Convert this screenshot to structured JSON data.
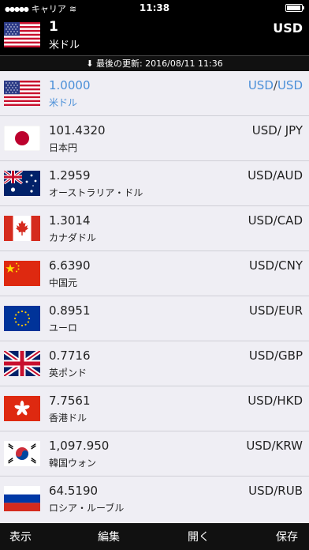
{
  "status_bar": {
    "carrier": "キャリア",
    "time": "11:38"
  },
  "header": {
    "amount": "1",
    "currency_name": "米ドル",
    "currency_code": "USD",
    "flag_icon": "us-flag-icon"
  },
  "updated": {
    "text": "⬇ 最後の更新: 2016/08/11 11:36"
  },
  "rates": [
    {
      "rate": "1.0000",
      "name": "米ドル",
      "base": "USD",
      "sep": "/",
      "quote": "USD",
      "flag": "us-flag-icon",
      "highlight": "#4a8fd8"
    },
    {
      "rate": "101.4320",
      "name": "日本円",
      "base": "USD",
      "sep": "/ ",
      "quote": "JPY",
      "flag": "jp-flag-icon"
    },
    {
      "rate": "1.2959",
      "name": "オーストラリア・ドル",
      "base": "USD",
      "sep": "/",
      "quote": "AUD",
      "flag": "au-flag-icon"
    },
    {
      "rate": "1.3014",
      "name": "カナダドル",
      "base": "USD",
      "sep": "/",
      "quote": "CAD",
      "flag": "ca-flag-icon"
    },
    {
      "rate": "6.6390",
      "name": "中国元",
      "base": "USD",
      "sep": "/",
      "quote": "CNY",
      "flag": "cn-flag-icon"
    },
    {
      "rate": "0.8951",
      "name": "ユーロ",
      "base": "USD",
      "sep": "/",
      "quote": "EUR",
      "flag": "eu-flag-icon"
    },
    {
      "rate": "0.7716",
      "name": "英ポンド",
      "base": "USD",
      "sep": "/",
      "quote": "GBP",
      "flag": "gb-flag-icon"
    },
    {
      "rate": "7.7561",
      "name": "香港ドル",
      "base": "USD",
      "sep": "/",
      "quote": "HKD",
      "flag": "hk-flag-icon"
    },
    {
      "rate": "1,097.950",
      "name": "韓国ウォン",
      "base": "USD",
      "sep": "/",
      "quote": "KRW",
      "flag": "kr-flag-icon"
    },
    {
      "rate": "64.5190",
      "name": "ロシア・ルーブル",
      "base": "USD",
      "sep": "/",
      "quote": "RUB",
      "flag": "ru-flag-icon"
    }
  ],
  "toolbar": {
    "display": "表示",
    "edit": "編集",
    "open": "開く",
    "save": "保存"
  }
}
